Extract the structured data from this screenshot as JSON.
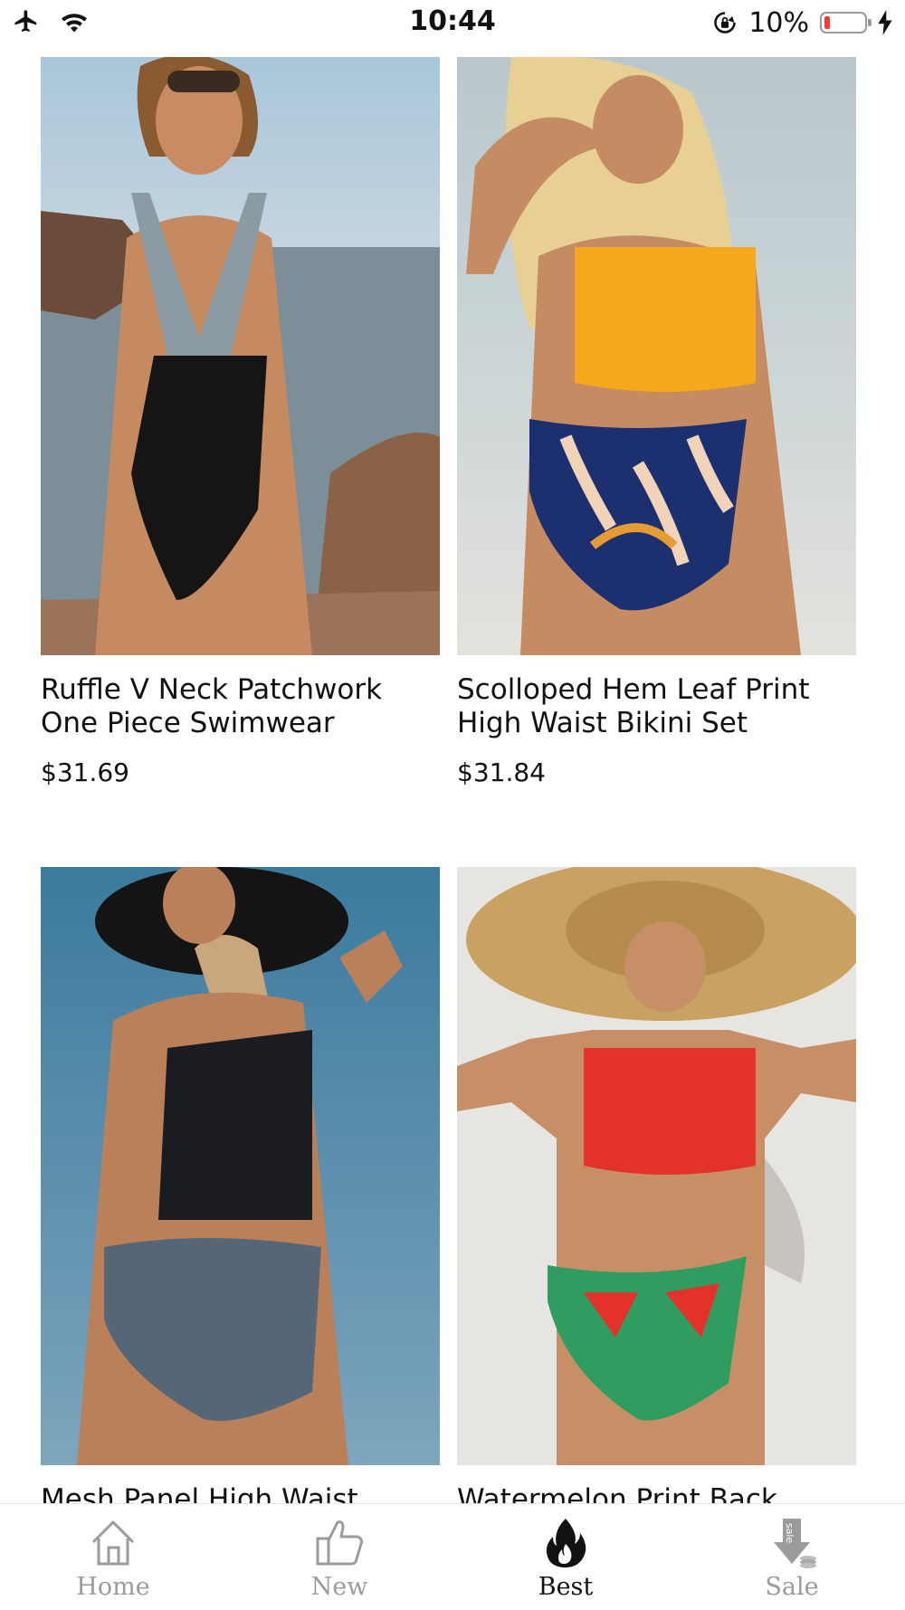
{
  "status_bar": {
    "time": "10:44",
    "battery_percent": "10%"
  },
  "products": [
    {
      "name_line1": "Ruffle V Neck Patchwork",
      "name_line2": "One Piece Swimwear",
      "price": "$31.69"
    },
    {
      "name_line1": "Scolloped Hem Leaf Print",
      "name_line2": "High Waist Bikini Set",
      "price": "$31.84"
    },
    {
      "name_line1": "Mesh Panel High Waist",
      "name_line2": "",
      "price": ""
    },
    {
      "name_line1": "Watermelon Print Back",
      "name_line2": "",
      "price": ""
    }
  ],
  "tabs": [
    {
      "label": "Home",
      "icon": "home-icon"
    },
    {
      "label": "New",
      "icon": "thumbs-up-icon"
    },
    {
      "label": "Best",
      "icon": "flame-icon"
    },
    {
      "label": "Sale",
      "icon": "sale-tag-icon"
    }
  ],
  "active_tab": "Best",
  "colors": {
    "active_tab": "#111111",
    "inactive_tab": "#9b9b9b",
    "battery_low": "#ff3b30"
  }
}
